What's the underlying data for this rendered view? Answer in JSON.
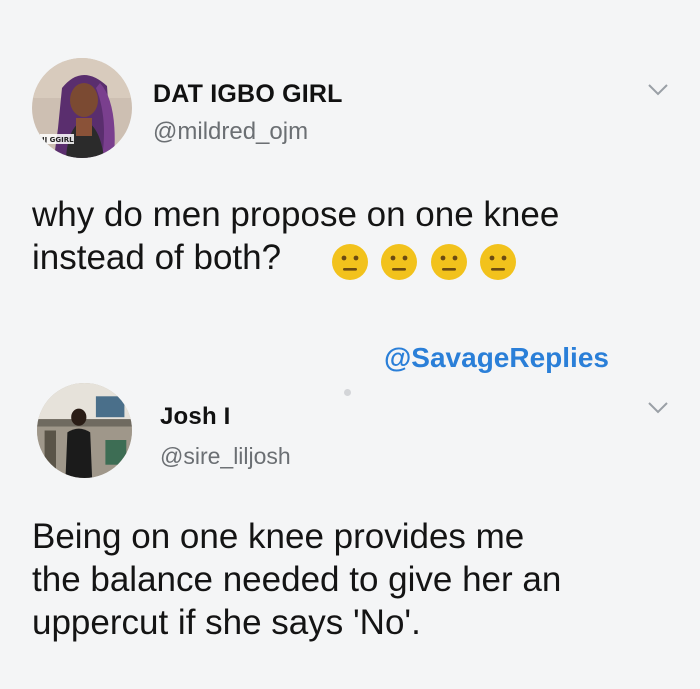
{
  "tweets": [
    {
      "display_name": "DAT IGBO GIRL",
      "handle": "@mildred_ojm",
      "text": "why do men propose on one knee instead of both?",
      "emojis": [
        "neutral-face-icon",
        "neutral-face-icon",
        "neutral-face-icon",
        "neutral-face-icon"
      ],
      "menu_icon": "chevron-down-icon",
      "avatar_badge": "IJ GGIRL"
    },
    {
      "display_name": "Josh I",
      "handle": "@sire_liljosh",
      "text_lines": [
        "Being on one knee provides me",
        "the balance needed to give her an",
        "uppercut if she says 'No'."
      ],
      "menu_icon": "chevron-down-icon"
    }
  ],
  "watermark": "@SavageReplies",
  "colors": {
    "background": "#f4f5f6",
    "text": "#141414",
    "muted": "#6b6f73",
    "accent": "#2a7fd8",
    "emoji": "#f2c21c"
  }
}
